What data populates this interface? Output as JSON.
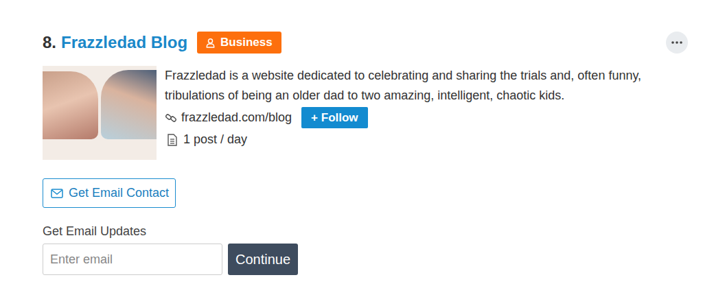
{
  "entry": {
    "rank": "8.",
    "title": "Frazzledad Blog",
    "badge": "Business",
    "description": "Frazzledad is a website dedicated to celebrating and sharing the trials and, often funny, tribulations of being an older dad to two amazing, intelligent, chaotic kids.",
    "url": "frazzledad.com/blog",
    "follow_button": "+ Follow",
    "frequency": "1 post / day"
  },
  "email_contact_button": "Get Email Contact",
  "email_updates": {
    "label": "Get Email Updates",
    "placeholder": "Enter email",
    "button": "Continue"
  }
}
